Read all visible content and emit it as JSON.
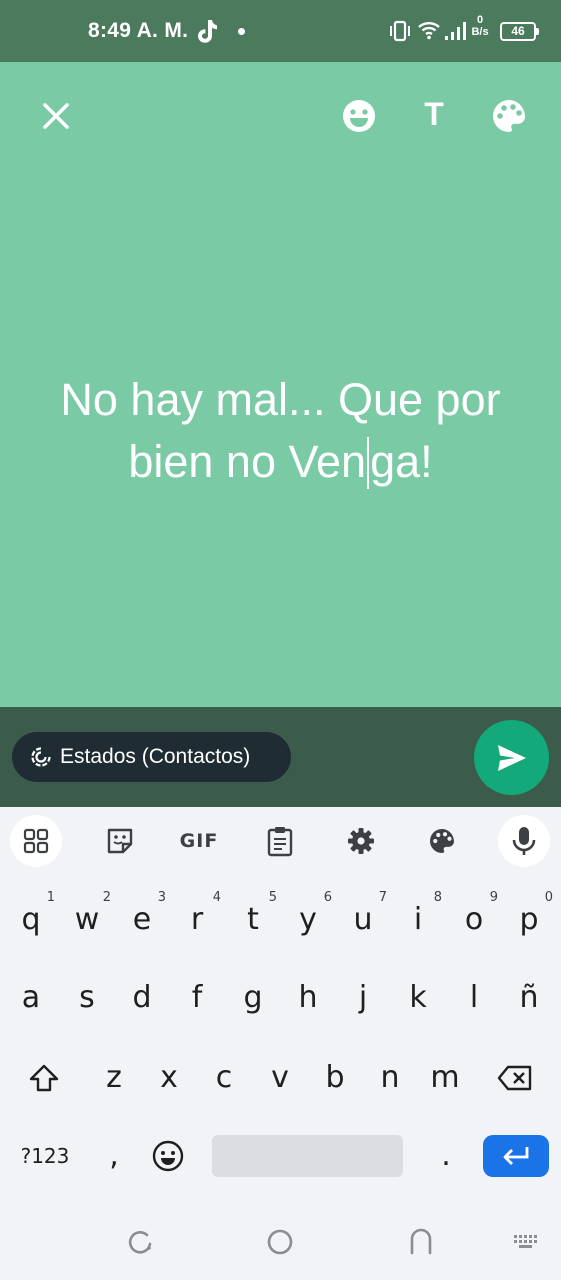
{
  "status_bar": {
    "time": "8:49 A. M.",
    "net_speed_value": "0",
    "net_speed_unit": "B/s",
    "battery": "46"
  },
  "composer": {
    "text_line1": "No hay mal... Que por",
    "text_line2_before_caret": "bien no Ven",
    "text_line2_after_caret": "ga!",
    "text_tool_label": "T",
    "background_color": "#7bcaa6"
  },
  "send_bar": {
    "audience_label": "Estados (Contactos)",
    "send_color": "#14a97a"
  },
  "keyboard": {
    "toolbar": {
      "gif_label": "GIF"
    },
    "row1": [
      {
        "label": "q",
        "hint": "1"
      },
      {
        "label": "w",
        "hint": "2"
      },
      {
        "label": "e",
        "hint": "3"
      },
      {
        "label": "r",
        "hint": "4"
      },
      {
        "label": "t",
        "hint": "5"
      },
      {
        "label": "y",
        "hint": "6"
      },
      {
        "label": "u",
        "hint": "7"
      },
      {
        "label": "i",
        "hint": "8"
      },
      {
        "label": "o",
        "hint": "9"
      },
      {
        "label": "p",
        "hint": "0"
      }
    ],
    "row2": [
      "a",
      "s",
      "d",
      "f",
      "g",
      "h",
      "j",
      "k",
      "l",
      "ñ"
    ],
    "row3": [
      "z",
      "x",
      "c",
      "v",
      "b",
      "n",
      "m"
    ],
    "row4": {
      "symbols_label": "?123",
      "comma_label": ",",
      "period_label": "."
    },
    "enter_color": "#1b73e8"
  }
}
